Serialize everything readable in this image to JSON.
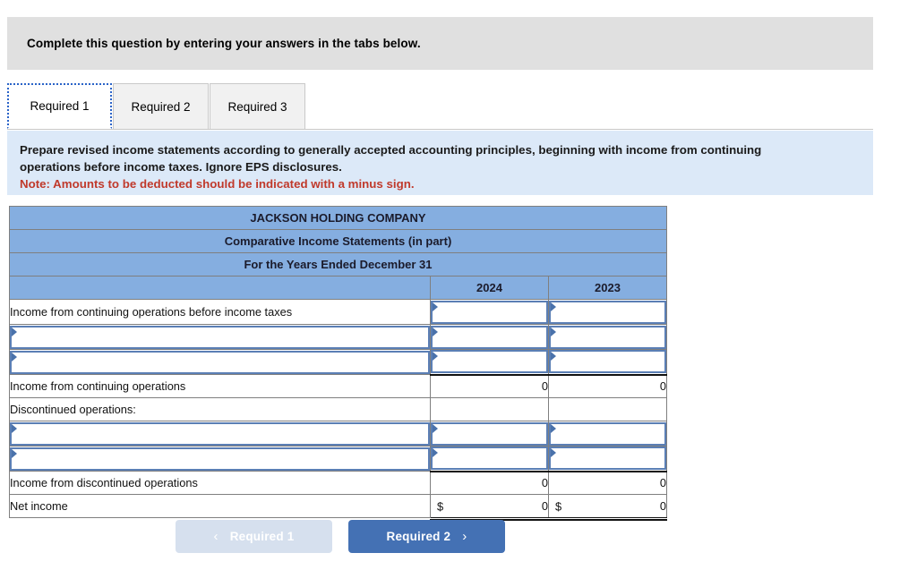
{
  "banner": {
    "text": "Complete this question by entering your answers in the tabs below."
  },
  "tabs": [
    {
      "label": "Required 1",
      "active": true
    },
    {
      "label": "Required 2",
      "active": false
    },
    {
      "label": "Required 3",
      "active": false
    }
  ],
  "instructions": {
    "body": "Prepare revised income statements according to generally accepted accounting principles, beginning with income from continuing operations before income taxes. Ignore EPS disclosures.",
    "note": "Note: Amounts to be deducted should be indicated with a minus sign."
  },
  "statement": {
    "title_lines": [
      "JACKSON HOLDING COMPANY",
      "Comparative Income Statements (in part)",
      "For the Years Ended December 31"
    ],
    "columns": [
      "",
      "2024",
      "2023"
    ],
    "rows": [
      {
        "label": "Income from continuing operations before income taxes",
        "type": "label-with-inputs",
        "y2024": "",
        "y2023": ""
      },
      {
        "label": "",
        "type": "input-row",
        "y2024": "",
        "y2023": ""
      },
      {
        "label": "",
        "type": "input-row",
        "y2024": "",
        "y2023": ""
      },
      {
        "label": "Income from continuing operations",
        "type": "total",
        "y2024": "0",
        "y2023": "0"
      },
      {
        "label": "Discontinued operations:",
        "type": "plain",
        "y2024": "",
        "y2023": ""
      },
      {
        "label": "",
        "type": "input-row",
        "y2024": "",
        "y2023": ""
      },
      {
        "label": "",
        "type": "input-row",
        "y2024": "",
        "y2023": ""
      },
      {
        "label": "Income from discontinued operations",
        "type": "total",
        "y2024": "0",
        "y2023": "0"
      },
      {
        "label": "Net income",
        "type": "grand-total",
        "currency": "$",
        "y2024": "0",
        "y2023": "0"
      }
    ]
  },
  "nav": {
    "prev_label": "Required 1",
    "prev_icon": "chevron-left-icon",
    "prev_chevron": "‹",
    "next_label": "Required 2",
    "next_icon": "chevron-right-icon",
    "next_chevron": "›"
  },
  "colors": {
    "banner_bg": "#e0e0e0",
    "instruction_bg": "#dce9f8",
    "note_text": "#c0392b",
    "table_header_bg": "#85aee0",
    "input_border": "#5b7fb5",
    "next_button_bg": "#4471b4",
    "prev_button_bg": "#d6e0ee"
  }
}
